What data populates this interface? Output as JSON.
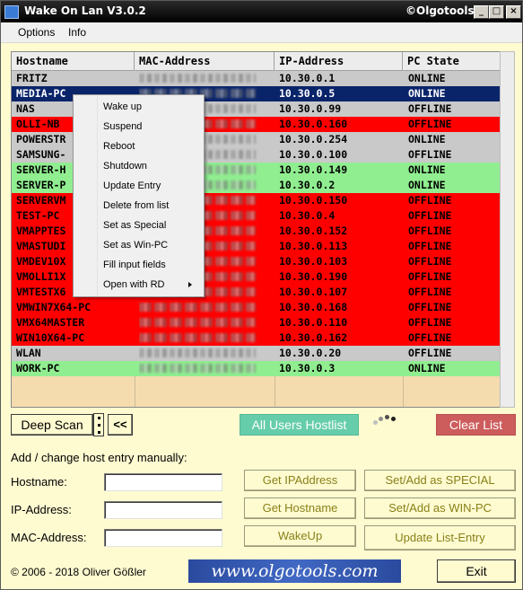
{
  "window": {
    "title": "Wake On Lan V3.0.2",
    "brand": "©Olgotools",
    "controls": {
      "minimize": "_",
      "maximize": "□",
      "close": "×"
    }
  },
  "menu": {
    "items": [
      "Options",
      "Info"
    ]
  },
  "table": {
    "columns": [
      "Hostname",
      "MAC-Address",
      "IP-Address",
      "PC State"
    ],
    "rows": [
      {
        "host": "FRITZ",
        "ip": "10.30.0.1",
        "state": "ONLINE",
        "color": "gray"
      },
      {
        "host": "MEDIA-PC",
        "ip": "10.30.0.5",
        "state": "ONLINE",
        "color": "selected"
      },
      {
        "host": "NAS",
        "ip": "10.30.0.99",
        "state": "OFFLINE",
        "color": "gray"
      },
      {
        "host": "OLLI-NB",
        "ip": "10.30.0.160",
        "state": "OFFLINE",
        "color": "red"
      },
      {
        "host": "POWERSTR",
        "ip": "10.30.0.254",
        "state": "ONLINE",
        "color": "gray"
      },
      {
        "host": "SAMSUNG-",
        "ip": "10.30.0.100",
        "state": "OFFLINE",
        "color": "gray"
      },
      {
        "host": "SERVER-H",
        "ip": "10.30.0.149",
        "state": "ONLINE",
        "color": "green"
      },
      {
        "host": "SERVER-P",
        "ip": "10.30.0.2",
        "state": "ONLINE",
        "color": "green"
      },
      {
        "host": "SERVERVM",
        "ip": "10.30.0.150",
        "state": "OFFLINE",
        "color": "red"
      },
      {
        "host": "TEST-PC",
        "ip": "10.30.0.4",
        "state": "OFFLINE",
        "color": "red"
      },
      {
        "host": "VMAPPTES",
        "ip": "10.30.0.152",
        "state": "OFFLINE",
        "color": "red"
      },
      {
        "host": "VMASTUDI",
        "ip": "10.30.0.113",
        "state": "OFFLINE",
        "color": "red"
      },
      {
        "host": "VMDEV10X",
        "ip": "10.30.0.103",
        "state": "OFFLINE",
        "color": "red"
      },
      {
        "host": "VMOLLI1X",
        "ip": "10.30.0.190",
        "state": "OFFLINE",
        "color": "red"
      },
      {
        "host": "VMTESTX6",
        "ip": "10.30.0.107",
        "state": "OFFLINE",
        "color": "red"
      },
      {
        "host": "VMWIN7X64-PC",
        "ip": "10.30.0.168",
        "state": "OFFLINE",
        "color": "red"
      },
      {
        "host": "VMX64MASTER",
        "ip": "10.30.0.110",
        "state": "OFFLINE",
        "color": "red"
      },
      {
        "host": "WIN10X64-PC",
        "ip": "10.30.0.162",
        "state": "OFFLINE",
        "color": "red"
      },
      {
        "host": "WLAN",
        "ip": "10.30.0.20",
        "state": "OFFLINE",
        "color": "gray"
      },
      {
        "host": "WORK-PC",
        "ip": "10.30.0.3",
        "state": "ONLINE",
        "color": "green"
      }
    ]
  },
  "context_menu": {
    "items": [
      "Wake up",
      "Suspend",
      "Reboot",
      "Shutdown",
      "Update Entry",
      "Delete from list",
      "Set as Special",
      "Set as Win-PC",
      "Fill input fields",
      "Open with RD"
    ]
  },
  "toolbar": {
    "deep_scan": "Deep Scan",
    "back": "<<",
    "all_users": "All Users Hostlist",
    "clear_list": "Clear List"
  },
  "form": {
    "heading": "Add / change host entry manually:",
    "hostname_label": "Hostname:",
    "ip_label": "IP-Address:",
    "mac_label": "MAC-Address:",
    "hostname_value": "",
    "ip_value": "",
    "mac_value": ""
  },
  "actions": {
    "get_ip": "Get IPAddress",
    "get_hostname": "Get Hostname",
    "wakeup": "WakeUp",
    "set_special": "Set/Add as SPECIAL",
    "set_winpc": "Set/Add as WIN-PC",
    "update_list": "Update List-Entry",
    "exit": "Exit"
  },
  "footer": {
    "copyright": "© 2006 - 2018  Oliver Gößler",
    "banner": "www.olgotools.com"
  },
  "colors": {
    "background": "#fffbd1",
    "table_bg": "#f4dcaf",
    "row_gray": "#c9c9c9",
    "row_red": "#ff0000",
    "row_green": "#90ee90",
    "row_selected": "#0a246a",
    "users_button": "#66cdaa",
    "clear_button": "#cd5c5c"
  },
  "icons": [
    "app-icon",
    "submenu-arrow-icon",
    "loading-spinner-icon"
  ]
}
